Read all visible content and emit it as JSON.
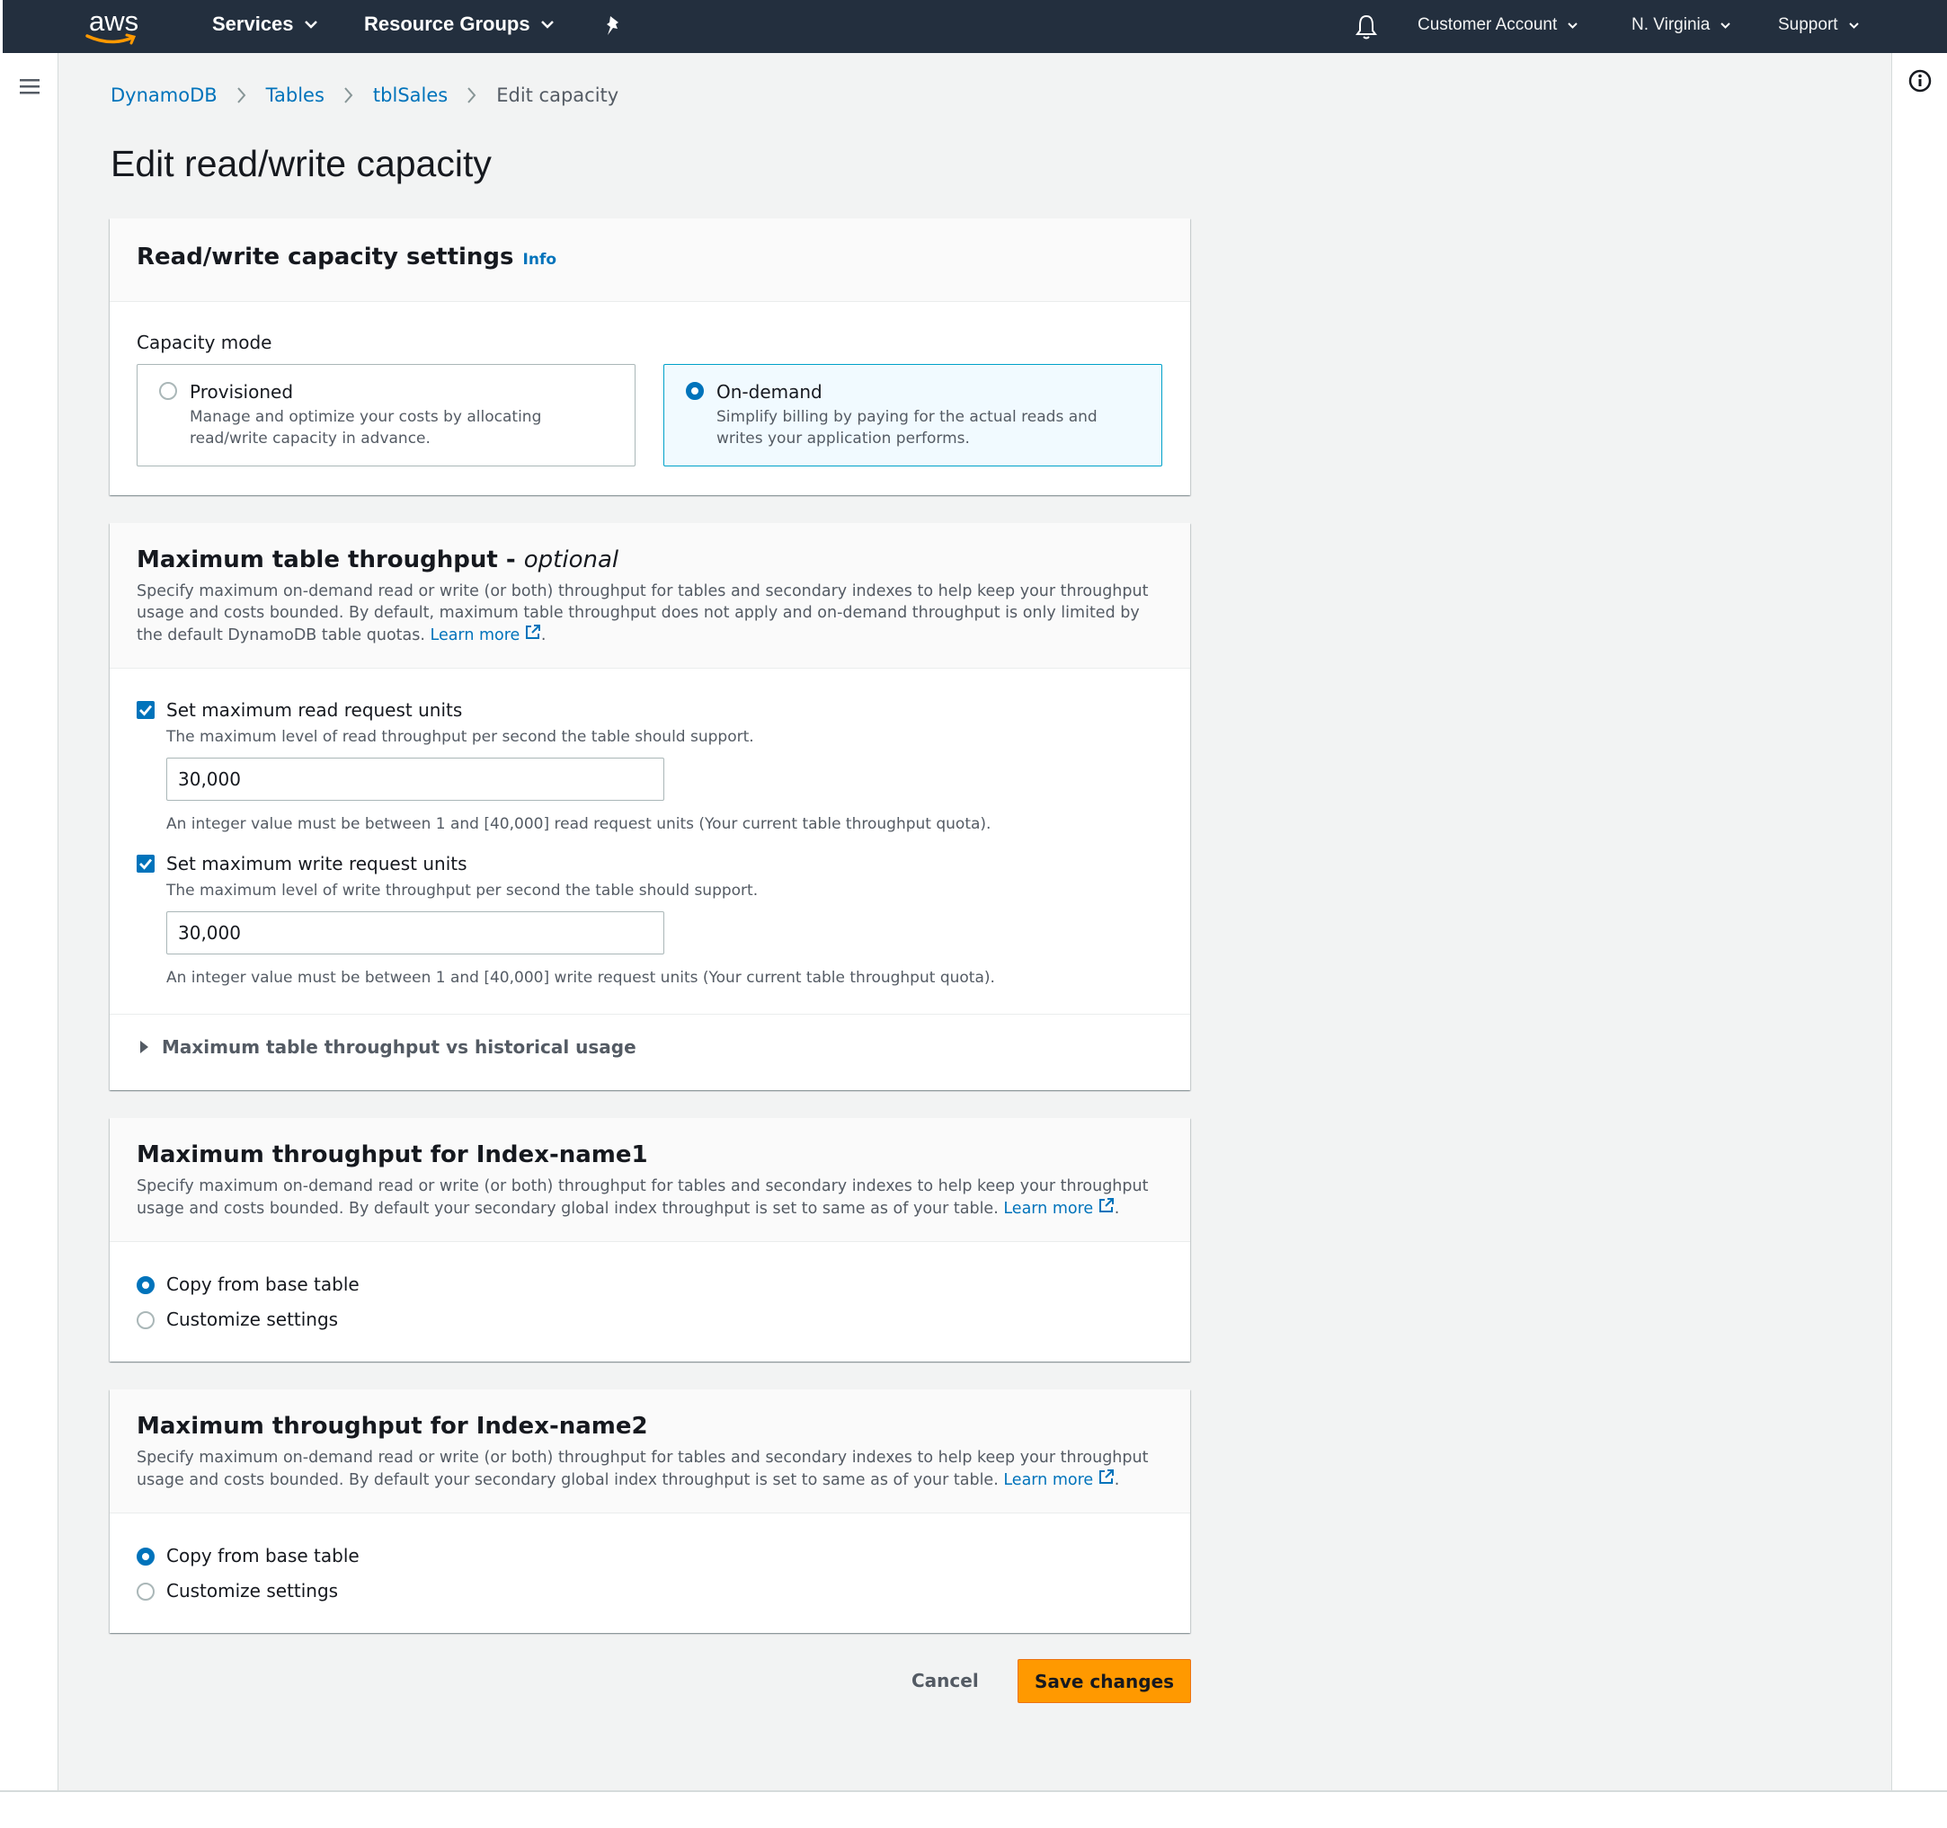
{
  "topnav": {
    "logo_text": "aws",
    "services": "Services",
    "resource_groups": "Resource Groups",
    "account": "Customer Account",
    "region": "N. Virginia",
    "support": "Support"
  },
  "breadcrumb": {
    "items": [
      "DynamoDB",
      "Tables",
      "tblSales"
    ],
    "current": "Edit capacity"
  },
  "page_title": "Edit read/write capacity",
  "capacity_panel": {
    "title": "Read/write capacity settings",
    "info": "Info",
    "mode_label": "Capacity mode",
    "provisioned": {
      "label": "Provisioned",
      "desc": "Manage and optimize your costs by allocating read/write capacity in advance.",
      "selected": false
    },
    "on_demand": {
      "label": "On-demand",
      "desc": "Simplify billing by paying for the actual reads and writes your application performs.",
      "selected": true
    }
  },
  "throughput_panel": {
    "title": "Maximum table throughput - ",
    "title_optional": "optional",
    "desc": "Specify maximum on-demand read or write (or both) throughput for tables and secondary indexes to help keep your throughput usage and costs bounded. By default, maximum table throughput does not apply and on-demand throughput is only limited by the default DynamoDB table quotas.",
    "learn_more": "Learn more",
    "read": {
      "checked": true,
      "label": "Set maximum read request units",
      "desc": "The maximum level of read throughput per second the table  should support.",
      "value": "30,000",
      "constraint": "An integer value must be between 1 and [40,000] read request units (Your current table throughput quota)."
    },
    "write": {
      "checked": true,
      "label": "Set maximum write request units",
      "desc": "The maximum level of write throughput per second the table should support.",
      "value": "30,000",
      "constraint": "An integer value must be between 1 and [40,000] write request units (Your current table throughput quota)."
    },
    "expandable": "Maximum table throughput vs historical usage"
  },
  "index1_panel": {
    "title": "Maximum throughput for Index-name1",
    "desc": "Specify maximum on-demand read or write (or both) throughput for tables and secondary indexes to help keep your throughput usage and costs bounded. By default your secondary global index throughput is set to same as of your table.",
    "learn_more": "Learn more",
    "copy": "Copy from base table",
    "customize": "Customize settings",
    "selected": "Copy from base table"
  },
  "index2_panel": {
    "title": "Maximum throughput for Index-name2",
    "desc": "Specify maximum on-demand read or write (or both) throughput for tables and secondary indexes to help keep your throughput usage and costs bounded. By default your secondary global index throughput is set to same as of your table.",
    "learn_more": "Learn more",
    "copy": "Copy from base table",
    "customize": "Customize settings",
    "selected": "Copy from base table"
  },
  "actions": {
    "cancel": "Cancel",
    "save": "Save changes"
  },
  "colors": {
    "nav_bg": "#232f3e",
    "link": "#0073bb",
    "primary_button": "#ff9900",
    "page_bg": "#f2f3f3"
  }
}
